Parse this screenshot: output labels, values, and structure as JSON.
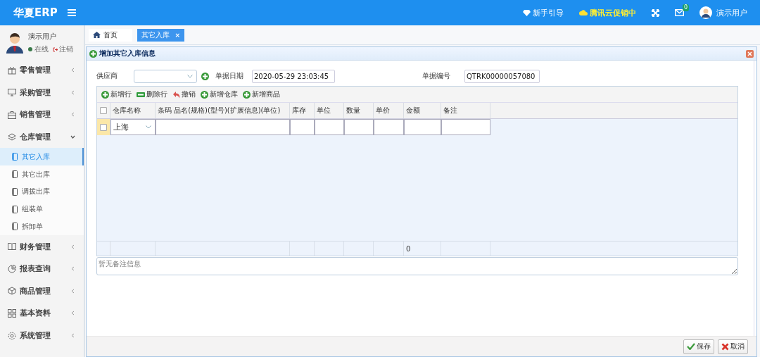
{
  "header": {
    "logo": "华夏ERP",
    "guide": "新手引导",
    "promo": "腾讯云促销中",
    "mail_count": "0",
    "user": "演示用户"
  },
  "user_panel": {
    "name": "演示用户",
    "status": "在线",
    "logout": "注销"
  },
  "menu": [
    {
      "label": "零售管理",
      "expanded": false
    },
    {
      "label": "采购管理",
      "expanded": false
    },
    {
      "label": "销售管理",
      "expanded": false
    },
    {
      "label": "仓库管理",
      "expanded": true,
      "children": [
        {
          "label": "其它入库",
          "selected": true
        },
        {
          "label": "其它出库",
          "selected": false
        },
        {
          "label": "调拨出库",
          "selected": false
        },
        {
          "label": "组装单",
          "selected": false
        },
        {
          "label": "拆卸单",
          "selected": false
        }
      ]
    },
    {
      "label": "财务管理",
      "expanded": false
    },
    {
      "label": "报表查询",
      "expanded": false
    },
    {
      "label": "商品管理",
      "expanded": false
    },
    {
      "label": "基本资料",
      "expanded": false
    },
    {
      "label": "系统管理",
      "expanded": false
    }
  ],
  "tabs": [
    {
      "label": "首页",
      "selected": false,
      "kind": "home"
    },
    {
      "label": "其它入库",
      "selected": true,
      "kind": "closable",
      "close": "×"
    }
  ],
  "panel": {
    "title": "增加其它入库信息"
  },
  "form": {
    "supplier_label": "供应商",
    "date_label": "单据日期",
    "date_value": "2020-05-29 23:03:45",
    "number_label": "单据编号",
    "number_value": "QTRK00000057080"
  },
  "toolbar": [
    {
      "label": "新增行",
      "kind": "add"
    },
    {
      "label": "删除行",
      "kind": "remove"
    },
    {
      "label": "撤销",
      "kind": "undo"
    },
    {
      "label": "新增仓库",
      "kind": "add"
    },
    {
      "label": "新增商品",
      "kind": "add"
    }
  ],
  "table": {
    "all_checked": false,
    "columns": [
      "仓库名称",
      "条码 品名(规格)(型号)(扩展信息)(单位)",
      "库存",
      "单位",
      "数量",
      "单价",
      "金额",
      "备注"
    ],
    "rows": [
      {
        "checked": false,
        "warehouse": "上海"
      }
    ],
    "footer_amount": "0"
  },
  "remark": {
    "placeholder": "暂无备注信息"
  },
  "buttons": [
    {
      "label": "保存",
      "kind": "save"
    },
    {
      "label": "取消",
      "kind": "cancel"
    }
  ]
}
